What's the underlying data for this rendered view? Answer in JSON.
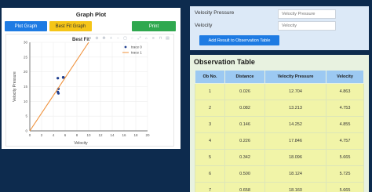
{
  "graph_panel": {
    "title": "Graph Plot",
    "buttons": {
      "plot_graph": "Plot Graph",
      "best_fit_graph": "Best Fit Graph",
      "print": "Print"
    }
  },
  "chart_data": {
    "type": "scatter",
    "title": "Best Fit",
    "xlabel": "Velocity",
    "ylabel": "Velocity Pressure",
    "xlim": [
      0,
      20
    ],
    "ylim": [
      0,
      30
    ],
    "xticks": [
      0,
      2,
      4,
      6,
      8,
      10,
      12,
      14,
      16,
      18,
      20
    ],
    "yticks": [
      0,
      5,
      10,
      15,
      20,
      25,
      30
    ],
    "legend": [
      "trace 0",
      "trace 1"
    ],
    "legend_position": "top-right",
    "series": [
      {
        "name": "trace 0",
        "kind": "markers",
        "color": "#1f3f8f",
        "x": [
          4.863,
          4.753,
          4.855,
          4.757,
          5.665,
          5.685,
          5.725,
          5.665
        ],
        "y": [
          12.704,
          13.213,
          14.252,
          17.846,
          18.096,
          18.124,
          18.058,
          18.16
        ]
      },
      {
        "name": "trace 1",
        "kind": "line",
        "color": "#f0913a",
        "x": [
          0,
          10
        ],
        "y": [
          0,
          30
        ]
      }
    ]
  },
  "form": {
    "velocity_pressure_label": "Velocity Pressure",
    "velocity_pressure_placeholder": "Velocity Pressure",
    "velocity_label": "Velocity",
    "velocity_placeholder": "Velocity",
    "add_button": "Add Result to Observation Table"
  },
  "observation_table": {
    "title": "Observation Table",
    "headers": [
      "Ob No.",
      "Distance",
      "Velocity Pressure",
      "Velocity"
    ],
    "rows": [
      [
        "1",
        "0.026",
        "12.704",
        "4.863"
      ],
      [
        "2",
        "0.082",
        "13.213",
        "4.753"
      ],
      [
        "3",
        "0.146",
        "14.252",
        "4.855"
      ],
      [
        "4",
        "0.226",
        "17.846",
        "4.757"
      ],
      [
        "5",
        "0.342",
        "18.096",
        "5.665"
      ],
      [
        "6",
        "0.500",
        "18.124",
        "5.725"
      ],
      [
        "7",
        "0.658",
        "18.160",
        "5.665"
      ]
    ]
  }
}
